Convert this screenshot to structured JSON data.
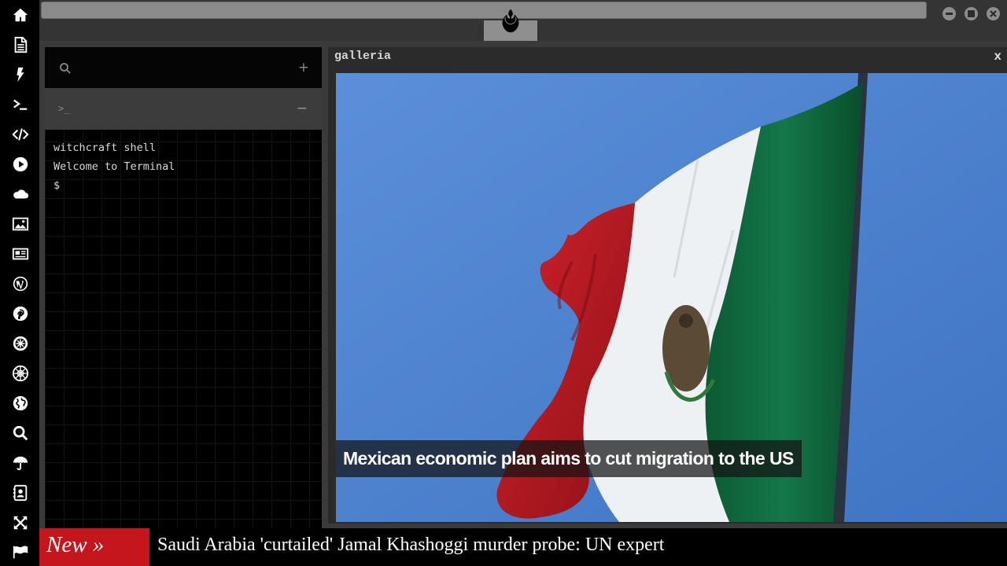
{
  "dock": {
    "items": [
      {
        "name": "home-icon"
      },
      {
        "name": "document-icon"
      },
      {
        "name": "bolt-icon"
      },
      {
        "name": "terminal-icon"
      },
      {
        "name": "code-icon"
      },
      {
        "name": "play-icon"
      },
      {
        "name": "cloud-icon"
      },
      {
        "name": "image-icon"
      },
      {
        "name": "newspaper-icon"
      },
      {
        "name": "wordpress-icon"
      },
      {
        "name": "pinterest-icon"
      },
      {
        "name": "jedi-order-icon"
      },
      {
        "name": "galactic-republic-icon"
      },
      {
        "name": "globe-icon"
      },
      {
        "name": "search-icon"
      },
      {
        "name": "umbrella-icon"
      },
      {
        "name": "contact-card-icon"
      },
      {
        "name": "expand-icon"
      },
      {
        "name": "flag-icon"
      }
    ]
  },
  "topbar": {
    "logo": "rebel-alliance-icon",
    "window_controls": [
      "minimize-icon",
      "maximize-icon",
      "close-icon"
    ]
  },
  "terminal": {
    "add_label": "+",
    "prompt_icon": ">_",
    "collapse_label": "−",
    "lines": [
      "witchcraft shell",
      "Welcome to Terminal",
      "$"
    ]
  },
  "galleria": {
    "title": "galleria",
    "close_label": "x",
    "caption": "Mexican economic plan aims to cut migration to the US",
    "colors": {
      "sky": "#4f84d1",
      "green": "#0f6b3e",
      "white": "#f1f3f4",
      "red": "#c41a22"
    }
  },
  "ticker": {
    "badge": "New »",
    "headline": "Saudi Arabia 'curtailed' Jamal Khashoggi murder probe: UN expert"
  }
}
